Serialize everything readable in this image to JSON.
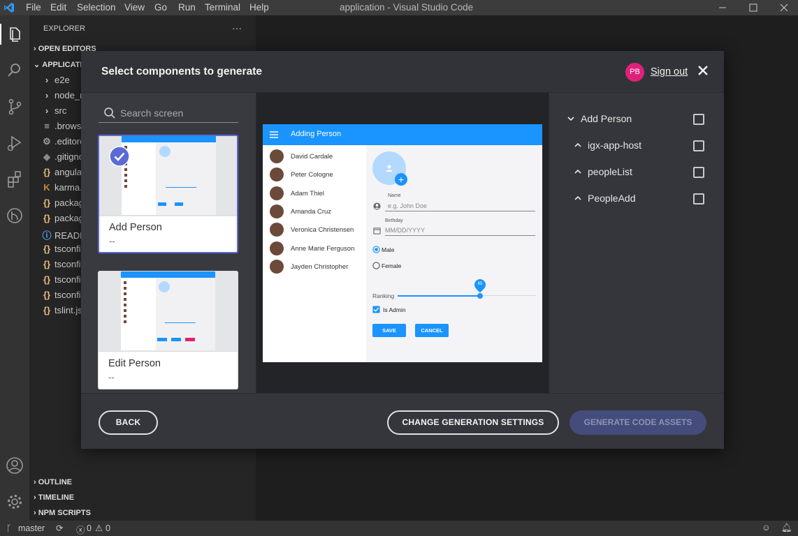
{
  "titlebar": {
    "menu": [
      "File",
      "Edit",
      "Selection",
      "View",
      "Go",
      "Run",
      "Terminal",
      "Help"
    ],
    "title": "application - Visual Studio Code"
  },
  "activity_icons": [
    "explorer-icon",
    "search-icon",
    "source-control-icon",
    "run-debug-icon",
    "extensions-icon",
    "remote-icon",
    "account-icon",
    "settings-gear-icon"
  ],
  "sidebar": {
    "header": "EXPLORER",
    "more": "···",
    "open_editors": "OPEN EDITORS",
    "application": "APPLICATIO",
    "files": [
      {
        "label": "e2e",
        "icon": "›"
      },
      {
        "label": "node_m",
        "icon": "›"
      },
      {
        "label": "src",
        "icon": "›"
      },
      {
        "label": ".browse",
        "icon": "≡"
      },
      {
        "label": ".editorc",
        "icon": "⚙"
      },
      {
        "label": ".gitigno",
        "icon": "◆"
      },
      {
        "label": "angula",
        "icon": "{}"
      },
      {
        "label": "karma.c",
        "icon": "K"
      },
      {
        "label": "packag",
        "icon": "{}"
      },
      {
        "label": "packag",
        "icon": "{}"
      },
      {
        "label": "READM",
        "icon": "ⓘ"
      },
      {
        "label": "tsconfi",
        "icon": "{}"
      },
      {
        "label": "tsconfi",
        "icon": "{}"
      },
      {
        "label": "tsconfi",
        "icon": "{}"
      },
      {
        "label": "tsconfi",
        "icon": "{}"
      },
      {
        "label": "tslint.js",
        "icon": "{}"
      }
    ],
    "outline": "OUTLINE",
    "timeline": "TIMELINE",
    "npm_scripts": "NPM SCRIPTS"
  },
  "statusbar": {
    "branch": "master",
    "errors": "0",
    "warnings": "0"
  },
  "modal": {
    "title": "Select components to generate",
    "avatar_initials": "PB",
    "sign_out": "Sign out",
    "search_placeholder": "Search screen",
    "cards": [
      {
        "name": "Add Person",
        "sub": "--",
        "selected": true
      },
      {
        "name": "Edit Person",
        "sub": "--",
        "selected": false
      }
    ],
    "tree": [
      {
        "label": "Add Person",
        "chevron": "down",
        "checked": false
      },
      {
        "label": "igx-app-host",
        "chevron": "up",
        "checked": false
      },
      {
        "label": "peopleList",
        "chevron": "up",
        "checked": false
      },
      {
        "label": "PeopleAdd",
        "chevron": "up",
        "checked": false
      }
    ],
    "buttons": {
      "back": "BACK",
      "change": "CHANGE GENERATION SETTINGS",
      "generate": "GENERATE CODE ASSETS"
    }
  },
  "preview": {
    "title": "Adding Person",
    "people": [
      "David Cardale",
      "Peter Cologne",
      "Adam Thiel",
      "Amanda Cruz",
      "Veronica Christensen",
      "Anne Marie Ferguson",
      "Jayden Christopher"
    ],
    "name_label": "Name",
    "name_placeholder": "e.g. John Doe",
    "birthday_label": "Birthday",
    "birthday_placeholder": "MM/DD/YYYY",
    "male": "Male",
    "female": "Female",
    "ranking_label": "Ranking",
    "ranking_value": "65",
    "is_admin": "Is Admin",
    "save": "SAVE",
    "cancel": "CANCEL"
  },
  "colors": {
    "accent": "#1a94ff",
    "avatar": "#e0217a",
    "selected_card_border": "#5b6ad6",
    "generate_bg": "#444c7c"
  }
}
